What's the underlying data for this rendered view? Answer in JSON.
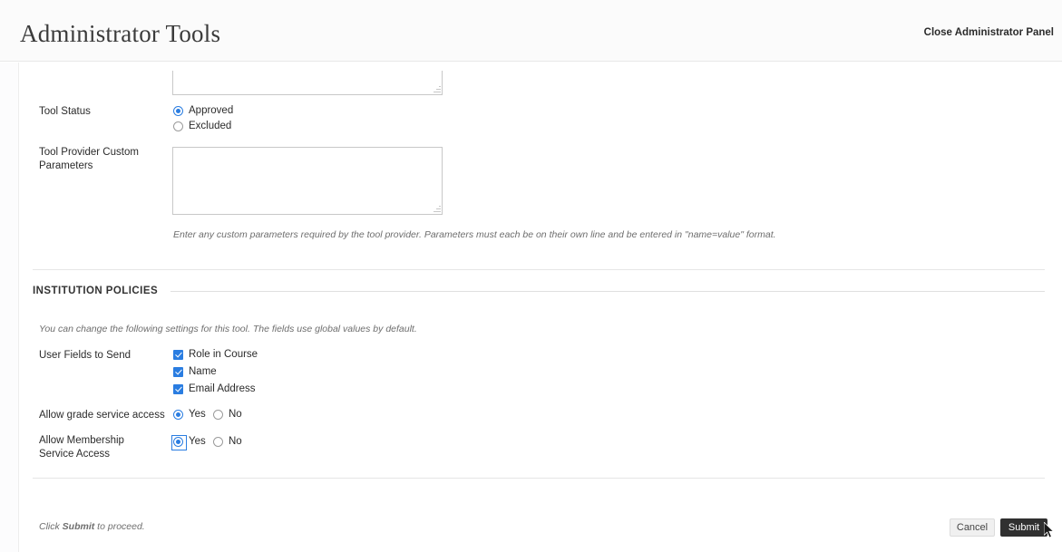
{
  "header": {
    "title": "Administrator Tools",
    "close_panel_label": "Close Administrator Panel"
  },
  "form": {
    "top_textarea": {
      "value": "",
      "placeholder": ""
    },
    "tool_status": {
      "label": "Tool Status",
      "options": [
        {
          "label": "Approved",
          "selected": true
        },
        {
          "label": "Excluded",
          "selected": false
        }
      ]
    },
    "custom_parameters": {
      "label": "Tool Provider Custom Parameters",
      "value": "",
      "placeholder": "",
      "help": "Enter any custom parameters required by the tool provider. Parameters must each be on their own line and be entered in \"name=value\" format."
    }
  },
  "institution_policies": {
    "section_title": "INSTITUTION POLICIES",
    "intro": "You can change the following settings for this tool. The fields use global values by default.",
    "user_fields": {
      "label": "User Fields to Send",
      "options": [
        {
          "label": "Role in Course",
          "checked": true
        },
        {
          "label": "Name",
          "checked": true
        },
        {
          "label": "Email Address",
          "checked": true
        }
      ]
    },
    "grade_service": {
      "label": "Allow grade service access",
      "options": [
        {
          "label": "Yes",
          "selected": true
        },
        {
          "label": "No",
          "selected": false
        }
      ]
    },
    "membership_service": {
      "label": "Allow Membership Service Access",
      "focused": true,
      "options": [
        {
          "label": "Yes",
          "selected": true
        },
        {
          "label": "No",
          "selected": false
        }
      ]
    }
  },
  "footer": {
    "instruction_prefix": "Click ",
    "instruction_bold": "Submit",
    "instruction_suffix": " to proceed.",
    "cancel_label": "Cancel",
    "submit_label": "Submit"
  },
  "colors": {
    "accent": "#2a7de1",
    "submit_bg": "#303030",
    "cancel_bg": "#f0f0f0",
    "header_bg": "#fbfbfb"
  }
}
